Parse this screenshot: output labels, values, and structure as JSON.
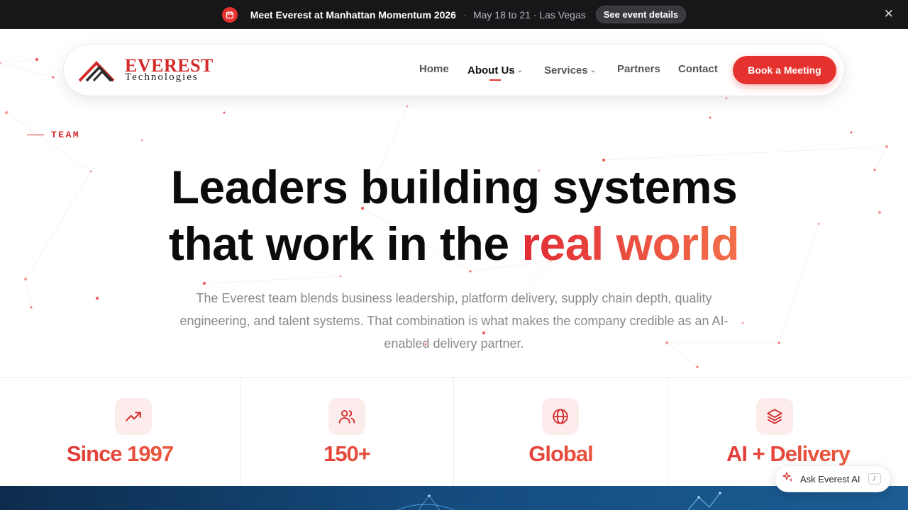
{
  "announcement": {
    "icon": "calendar-icon",
    "title": "Meet Everest at Manhattan Momentum 2026",
    "separator": "·",
    "details": "May 18 to 21 · Las Vegas",
    "button_label": "See event details",
    "close_icon": "close-icon"
  },
  "nav": {
    "logo": {
      "word": "EVEREST",
      "sub": "Technologies"
    },
    "items": [
      {
        "label": "Home",
        "dropdown": false
      },
      {
        "label": "About Us",
        "dropdown": true,
        "active": true
      },
      {
        "label": "Services",
        "dropdown": true
      },
      {
        "label": "Partners",
        "dropdown": false
      },
      {
        "label": "Contact",
        "dropdown": false
      }
    ],
    "cta_label": "Book a Meeting"
  },
  "hero": {
    "eyebrow": "TEAM",
    "headline_line1": "Leaders building systems",
    "headline_line2_plain": "that work in the ",
    "headline_line2_accent": "real world",
    "lede": "The Everest team blends business leadership, platform delivery, supply chain depth, quality engineering, and talent systems. That combination is what makes the company credible as an AI-enabled delivery partner."
  },
  "stats": [
    {
      "icon": "trending-up-icon",
      "value": "Since 1997"
    },
    {
      "icon": "users-icon",
      "value": "150+"
    },
    {
      "icon": "globe-icon",
      "value": "Global"
    },
    {
      "icon": "layers-icon",
      "value": "AI + Delivery"
    }
  ],
  "assistant": {
    "icon": "sparkles-icon",
    "label": "Ask Everest AI",
    "shortcut": "/"
  },
  "colors": {
    "brand_red": "#e5322e",
    "accent_orange": "#f2704a",
    "announce_bg": "#17171a",
    "band_blue": "#144a7c"
  }
}
